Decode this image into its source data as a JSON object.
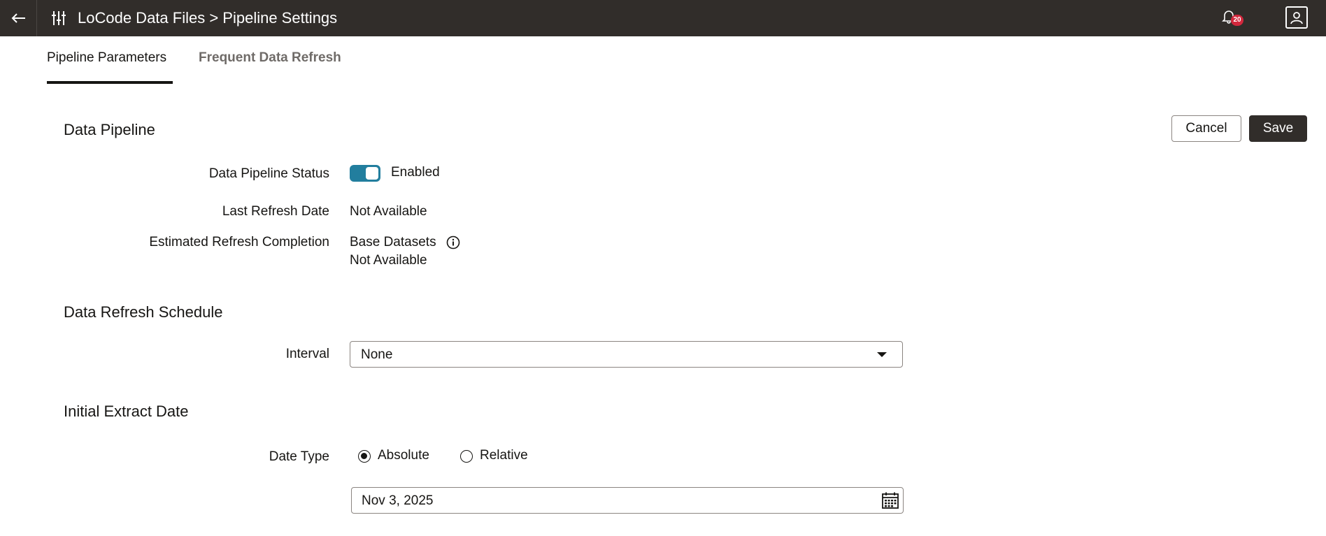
{
  "header": {
    "title": "LoCode Data Files > Pipeline Settings",
    "notifications_count": "20",
    "back_icon": "arrow-left-icon",
    "app_icon": "sliders-icon",
    "bell_icon": "bell-icon",
    "profile_icon": "user-profile-icon"
  },
  "tabs": [
    {
      "label": "Pipeline Parameters",
      "active": true
    },
    {
      "label": "Frequent Data Refresh",
      "active": false
    }
  ],
  "actions": {
    "cancel_label": "Cancel",
    "save_label": "Save"
  },
  "data_pipeline": {
    "title": "Data Pipeline",
    "status_label": "Data Pipeline Status",
    "status_value": "Enabled",
    "status_enabled": true,
    "last_refresh_label": "Last Refresh Date",
    "last_refresh_value": "Not Available",
    "estimated_label": "Estimated Refresh Completion",
    "estimated_dataset": "Base Datasets",
    "estimated_value": "Not Available"
  },
  "schedule": {
    "title": "Data Refresh Schedule",
    "interval_label": "Interval",
    "interval_value": "None"
  },
  "initial_extract": {
    "title": "Initial Extract Date",
    "date_type_label": "Date Type",
    "options": [
      "Absolute",
      "Relative"
    ],
    "selected": "Absolute",
    "date_value": "Nov 3, 2025"
  },
  "colors": {
    "header_bg": "#312d2a",
    "toggle_on": "#227e9e",
    "badge": "#d3283d"
  }
}
